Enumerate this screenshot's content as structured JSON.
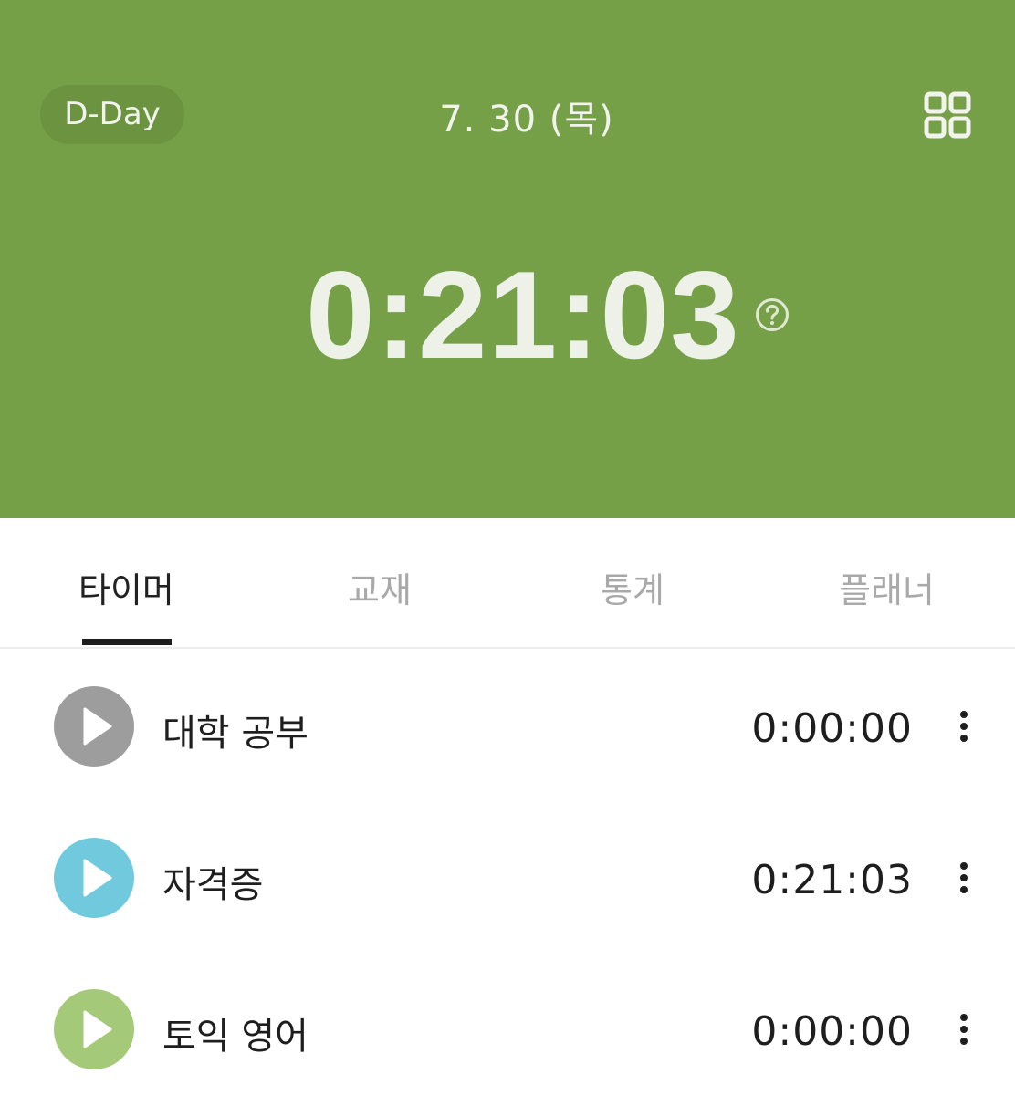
{
  "header": {
    "dday_label": "D-Day",
    "date": "7. 30 (목)",
    "total_time": "0:21:03",
    "menu_icon": "grid-icon",
    "help_icon": "question-circle-icon",
    "background_color": "#76a048"
  },
  "tabs": [
    {
      "label": "타이머",
      "active": true
    },
    {
      "label": "교재",
      "active": false
    },
    {
      "label": "통계",
      "active": false
    },
    {
      "label": "플래너",
      "active": false
    }
  ],
  "subjects": [
    {
      "name": "대학 공부",
      "time": "0:00:00",
      "color": "#9d9d9d",
      "icon": "play-icon",
      "more_icon": "more-vertical-icon"
    },
    {
      "name": "자격증",
      "time": "0:21:03",
      "color": "#71c9de",
      "icon": "play-icon",
      "more_icon": "more-vertical-icon"
    },
    {
      "name": "토익 영어",
      "time": "0:00:00",
      "color": "#a4c979",
      "icon": "play-icon",
      "more_icon": "more-vertical-icon"
    }
  ]
}
